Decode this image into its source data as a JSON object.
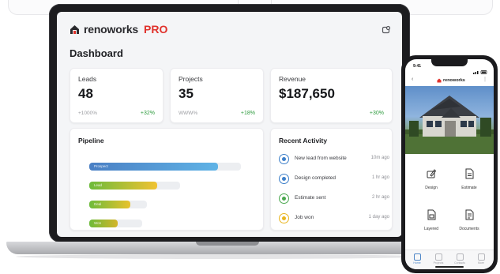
{
  "app": {
    "brand": "renoworks",
    "badge": "PRO",
    "page_title": "Dashboard"
  },
  "colors": {
    "accent_red": "#e0322c",
    "positive": "#2e9b3e",
    "pipeline_blue": "#3d8fd6",
    "pipeline_yellow": "#f1c232",
    "pipeline_green": "#6dbb3a"
  },
  "stats": [
    {
      "label": "Leads",
      "value": "48",
      "sub": "+1000%",
      "delta": "+32%"
    },
    {
      "label": "Projects",
      "value": "35",
      "sub": "WWW%",
      "delta": "+18%"
    },
    {
      "label": "Revenue",
      "value": "$187,650",
      "sub": "",
      "delta": "+30%"
    }
  ],
  "pipeline": {
    "title": "Pipeline",
    "bars": [
      {
        "label": "Prospect",
        "fill": 0.85,
        "track": 1.0,
        "color": "blue"
      },
      {
        "label": "Lead",
        "fill": 0.45,
        "track": 0.6,
        "color": "yellow"
      },
      {
        "label": "Deal",
        "fill": 0.27,
        "track": 0.38,
        "color": "green-yellow"
      },
      {
        "label": "Won",
        "fill": 0.19,
        "track": 0.35,
        "color": "green"
      }
    ]
  },
  "activity": {
    "title": "Recent Activity",
    "items": [
      {
        "text": "New lead from website",
        "time": "10m ago",
        "color": "#3d7fc9"
      },
      {
        "text": "Design completed",
        "time": "1 hr ago",
        "color": "#3d7fc9"
      },
      {
        "text": "Estimate sent",
        "time": "2 hr ago",
        "color": "#4aa84f"
      },
      {
        "text": "Job won",
        "time": "1 day ago",
        "color": "#e9b51f"
      }
    ]
  },
  "phone": {
    "status_time": "9:41",
    "brand": "renoworks",
    "tiles": [
      "Design",
      "Estimate",
      "Layered",
      "Documents"
    ],
    "tabs": [
      "Home",
      "Projects",
      "Contacts",
      "More"
    ]
  },
  "icons": [
    "brand-house-icon",
    "header-settings-icon",
    "back-icon",
    "menu-icon",
    "design-icon",
    "estimate-icon",
    "layered-icon",
    "documents-icon"
  ]
}
